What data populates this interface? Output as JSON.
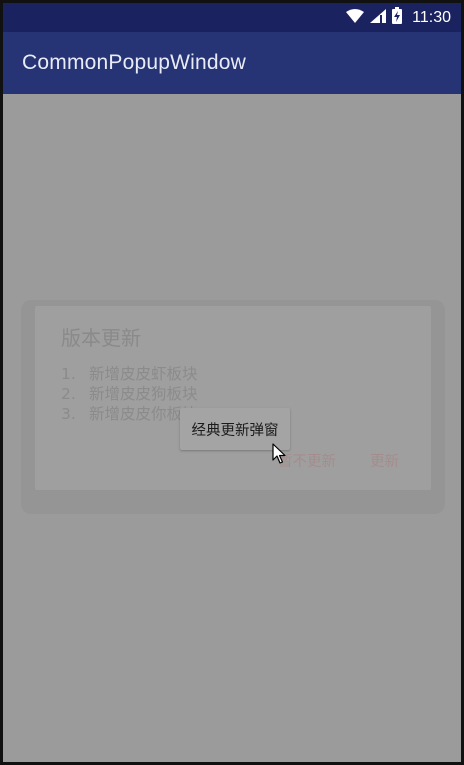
{
  "status_bar": {
    "time": "11:30",
    "icons": [
      "wifi-icon",
      "signal-icon",
      "battery-charging-icon"
    ]
  },
  "app_bar": {
    "title": "CommonPopupWindow"
  },
  "dialog": {
    "title": "版本更新",
    "items": [
      {
        "num": "1.",
        "text": "新增皮皮虾板块"
      },
      {
        "num": "2.",
        "text": "新增皮皮狗板块"
      },
      {
        "num": "3.",
        "text": "新增皮皮你板块"
      }
    ],
    "cancel_label": "暂不更新",
    "confirm_label": "更新"
  },
  "toast_button": {
    "label": "经典更新弹窗"
  },
  "colors": {
    "status_bar": "#1a2260",
    "app_bar": "#263374",
    "scrim": "#9b9b9b"
  }
}
